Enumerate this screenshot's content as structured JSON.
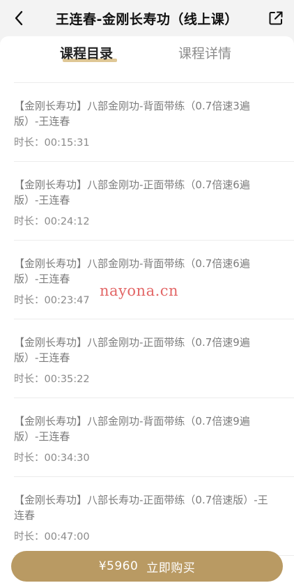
{
  "header": {
    "title": "王连春-金刚长寿功（线上课）",
    "back_icon": "chevron-left-icon",
    "share_icon": "share-icon"
  },
  "tabs": [
    {
      "label": "课程目录",
      "active": true
    },
    {
      "label": "课程详情",
      "active": false
    }
  ],
  "lessons": [
    {
      "title": "【金刚长寿功】八部金刚功-背面带练（0.7倍速3遍版）-王连春",
      "duration": "时长：00:15:31"
    },
    {
      "title": "【金刚长寿功】八部金刚功-正面带练（0.7倍速6遍版）-王连春",
      "duration": "时长：00:24:12"
    },
    {
      "title": "【金刚长寿功】八部金刚功-背面带练（0.7倍速6遍版）-王连春",
      "duration": "时长：00:23:47"
    },
    {
      "title": "【金刚长寿功】八部金刚功-正面带练（0.7倍速9遍版）-王连春",
      "duration": "时长：00:35:22"
    },
    {
      "title": "【金刚长寿功】八部金刚功-背面带练（0.7倍速9遍版）-王连春",
      "duration": "时长：00:34:30"
    },
    {
      "title": "【金刚长寿功】八部长寿功-正面带练（0.7倍速版）-王连春",
      "duration": "时长：00:47:00"
    }
  ],
  "buy_button": {
    "price": "¥5960",
    "label": "立即购买"
  },
  "watermark": "nayona.cn",
  "colors": {
    "accent": "#b99a63",
    "underline": "#d9bd83",
    "watermark": "#e05a5a"
  }
}
